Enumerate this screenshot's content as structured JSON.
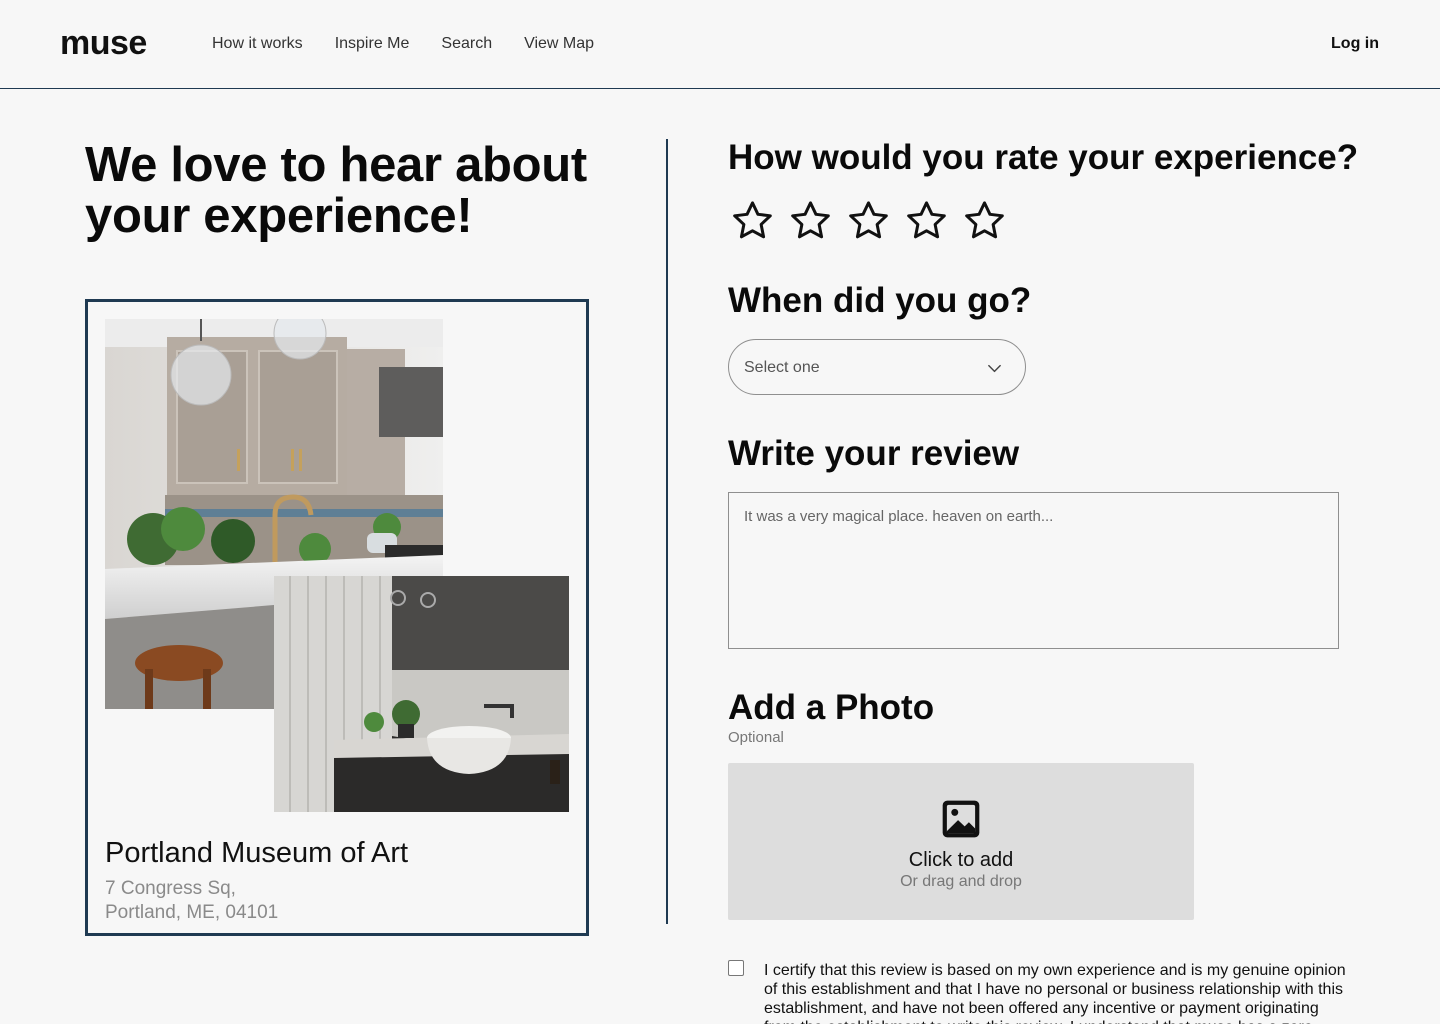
{
  "header": {
    "logo": "muse",
    "nav": [
      "How it works",
      "Inspire Me",
      "Search",
      "View Map"
    ],
    "login": "Log in"
  },
  "left": {
    "title_line1": "We love to hear about",
    "title_line2": "your experience!",
    "place": {
      "name": "Portland Museum of Art",
      "address_line1": "7 Congress Sq,",
      "address_line2": "Portland, ME, 04101"
    }
  },
  "form": {
    "rating": {
      "question": "How would you rate your experience?",
      "max_stars": 5,
      "selected": 0
    },
    "date": {
      "question": "When did you go?",
      "placeholder": "Select one"
    },
    "review": {
      "heading": "Write your review",
      "placeholder": "It was a very magical place. heaven on earth..."
    },
    "photo": {
      "heading": "Add a Photo",
      "optional_label": "Optional",
      "cta": "Click to add",
      "sub": "Or drag and drop"
    },
    "certify_text": "I certify that this review is based on my own experience and is my genuine opinion of this establishment and that I have no personal or business relationship with this establishment, and have not been offered any incentive or payment originating from the establishment to write this review. I understand that muse has a zero"
  },
  "icons": {
    "star": "star-outline-icon",
    "chevron": "chevron-down-icon",
    "image": "image-icon"
  }
}
